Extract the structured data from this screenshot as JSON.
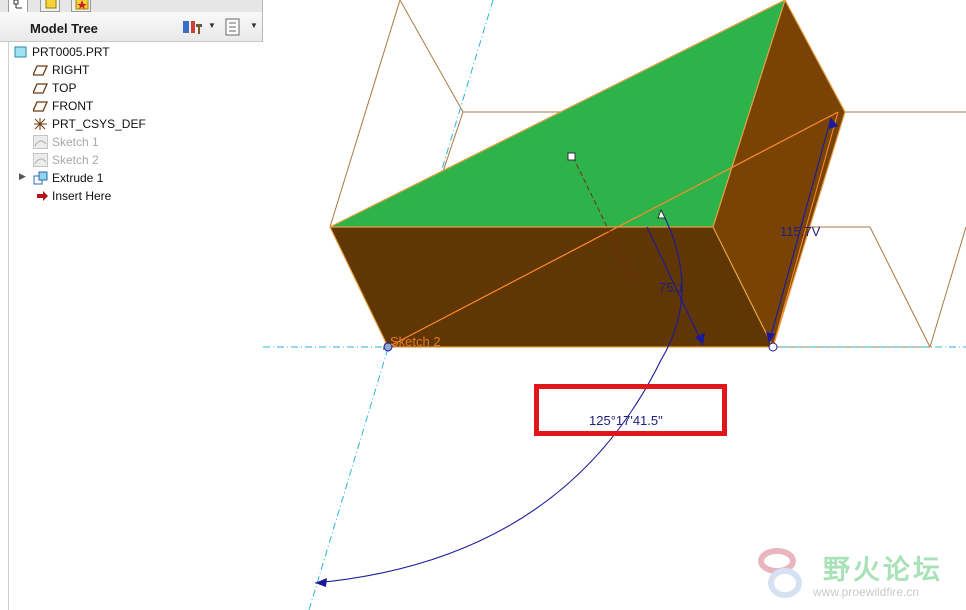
{
  "model_tree": {
    "title": "Model Tree",
    "items": [
      {
        "label": "PRT0005.PRT",
        "icon": "part-icon"
      },
      {
        "label": "RIGHT",
        "icon": "datum-plane-icon"
      },
      {
        "label": "TOP",
        "icon": "datum-plane-icon"
      },
      {
        "label": "FRONT",
        "icon": "datum-plane-icon"
      },
      {
        "label": "PRT_CSYS_DEF",
        "icon": "coordinate-system-icon"
      },
      {
        "label": "Sketch 1",
        "icon": "sketch-icon"
      },
      {
        "label": "Sketch 2",
        "icon": "sketch-icon"
      },
      {
        "label": "Extrude 1",
        "icon": "extrude-icon"
      },
      {
        "label": "Insert Here",
        "icon": "insert-here-arrow-icon"
      }
    ]
  },
  "viewport": {
    "sketch_label": "Sketch 2",
    "angle_dimension": "125°17'41.5\"",
    "dim_75": "75.1",
    "dim_115": "115.7V",
    "colors": {
      "top_face": "#2db34a",
      "front_face": "#5f3604",
      "side_face": "#7a4306",
      "dimension": "#1a1a9a",
      "highlight_box": "#e0161b",
      "datum_axis": "#29b5d9"
    }
  },
  "watermark": {
    "title": "野火论坛",
    "url": "www.proewildfire.cn"
  }
}
